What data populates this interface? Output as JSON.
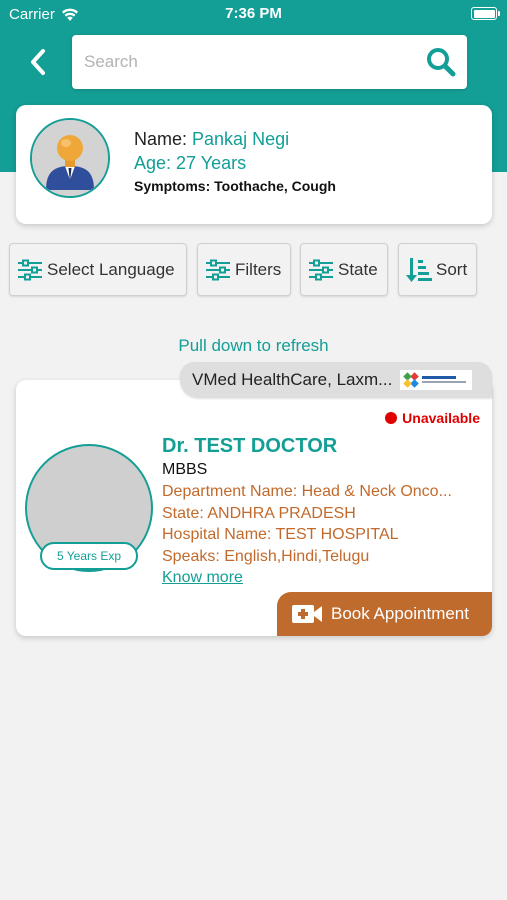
{
  "status_bar": {
    "carrier": "Carrier",
    "time": "7:36 PM"
  },
  "search": {
    "placeholder": "Search"
  },
  "patient": {
    "name_label": "Name: ",
    "name": "Pankaj Negi",
    "age": "Age: 27 Years",
    "symptoms": "Symptoms: Toothache, Cough"
  },
  "filters": {
    "select_language": "Select Language",
    "filters": "Filters",
    "state": "State",
    "sort": "Sort"
  },
  "pull_to_refresh": "Pull down to refresh",
  "doctor_card": {
    "clinic_name": "VMed HealthCare, Laxm...",
    "availability": "Unavailable",
    "experience": "5 Years Exp",
    "name": "Dr. TEST DOCTOR",
    "degree": "MBBS",
    "department": "Department Name: Head & Neck Onco...",
    "state": "State: ANDHRA PRADESH",
    "hospital": "Hospital Name: TEST HOSPITAL",
    "speaks": "Speaks: English,Hindi,Telugu",
    "know_more": "Know more",
    "book_label": "Book Appointment"
  },
  "colors": {
    "primary": "#139e96",
    "accent_orange": "#bf6b2e",
    "unavailable_red": "#e00000",
    "background": "#f2f2f2"
  },
  "icons": [
    "wifi-icon",
    "battery-icon",
    "back-arrow-icon",
    "search-icon",
    "sliders-icon",
    "sort-icon",
    "video-call-icon",
    "person-avatar-icon"
  ]
}
